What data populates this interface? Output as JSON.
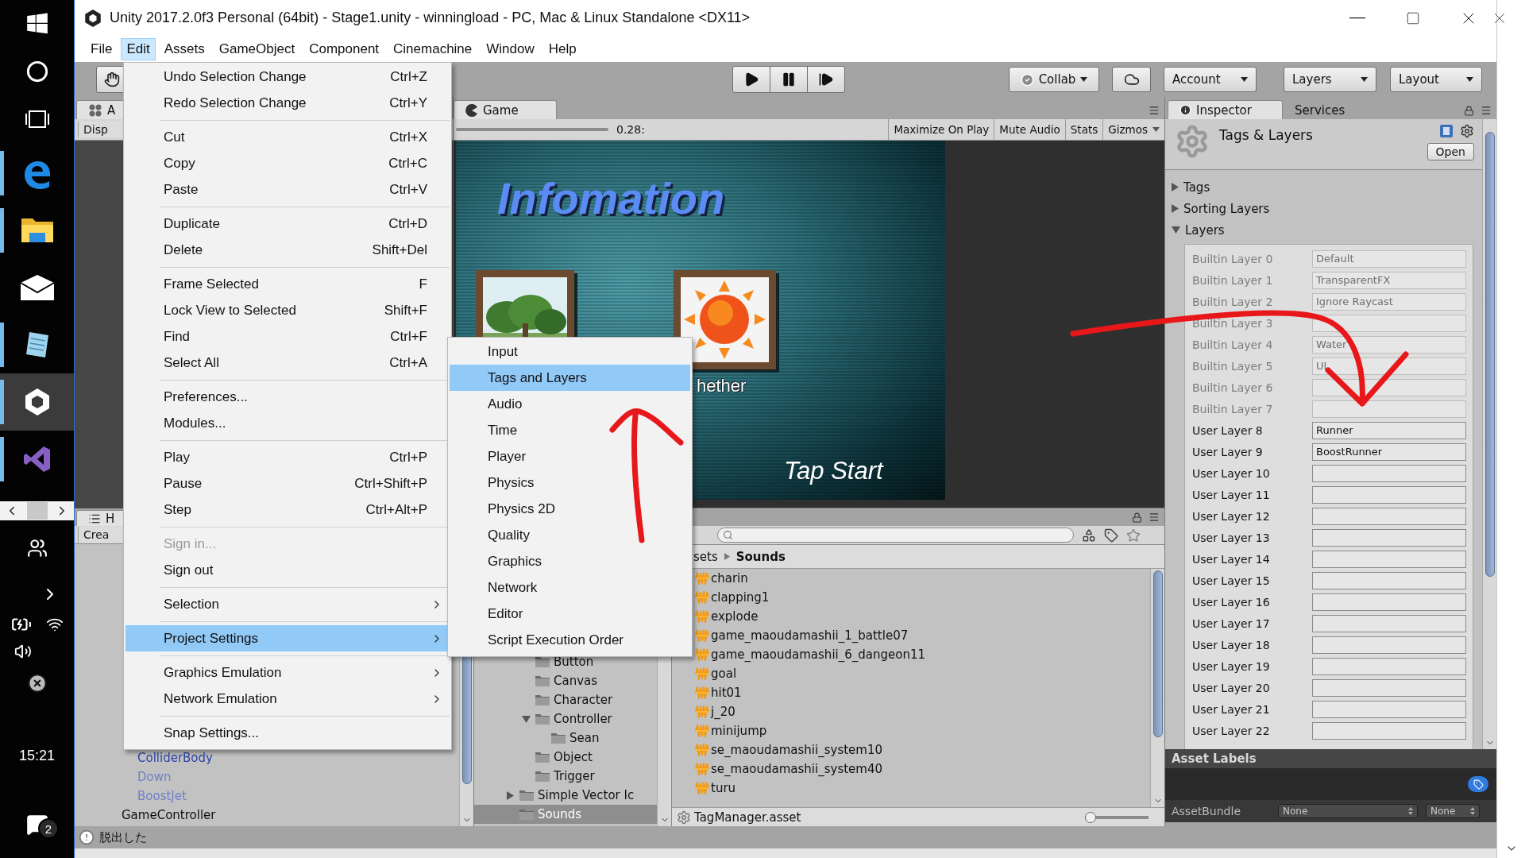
{
  "taskbar": {
    "apps": [
      {
        "kind": "edge",
        "running": true,
        "selected": false
      },
      {
        "kind": "explorer",
        "running": true,
        "selected": false
      },
      {
        "kind": "mail",
        "running": false,
        "selected": false
      },
      {
        "kind": "notepad",
        "running": true,
        "selected": false
      },
      {
        "kind": "unity",
        "running": true,
        "selected": true
      },
      {
        "kind": "studio",
        "running": true,
        "selected": false
      }
    ],
    "clock": "15:21",
    "notification_count": "2"
  },
  "window": {
    "title": "Unity 2017.2.0f3 Personal (64bit) - Stage1.unity - winningload - PC, Mac & Linux Standalone <DX11>"
  },
  "menubar": [
    {
      "label": "File",
      "selected": false
    },
    {
      "label": "Edit",
      "selected": true
    },
    {
      "label": "Assets",
      "selected": false
    },
    {
      "label": "GameObject",
      "selected": false
    },
    {
      "label": "Component",
      "selected": false
    },
    {
      "label": "Cinemachine",
      "selected": false
    },
    {
      "label": "Window",
      "selected": false
    },
    {
      "label": "Help",
      "selected": false
    }
  ],
  "toolbar": {
    "collab": "Collab",
    "account": "Account",
    "layers": "Layers",
    "layout": "Layout"
  },
  "scene_panel": {
    "tab": "A",
    "button": "Disp"
  },
  "game_panel": {
    "tab": "Game",
    "scale": "0.28:",
    "options": [
      "Maximize On Play",
      "Mute Audio",
      "Stats",
      "Gizmos"
    ],
    "title": "Infomation",
    "caption": "hether",
    "prompt": "Tap Start"
  },
  "hierarchy": {
    "tab": "H",
    "create": "Crea",
    "items": [
      {
        "children": [
          {
            "label": "ColliderBody",
            "kind": "prefab",
            "inactive": false
          },
          {
            "label": "Down",
            "kind": "prefab",
            "inactive": true
          },
          {
            "label": "BoostJet",
            "kind": "prefab",
            "inactive": true
          }
        ]
      },
      {
        "label": "GameController",
        "kind": "object",
        "inactive": false
      }
    ]
  },
  "project": {
    "folders": [
      {
        "children": [
          {
            "label": "Button",
            "selected": false
          },
          {
            "label": "Canvas",
            "selected": false
          },
          {
            "label": "Character",
            "selected": false
          },
          {
            "label": "Controller",
            "selected": false,
            "expanded": true,
            "children": [
              {
                "label": "Sean",
                "selected": false
              }
            ]
          },
          {
            "label": "Object",
            "selected": false
          },
          {
            "label": "Trigger",
            "selected": false
          }
        ]
      },
      {
        "label": "Simple Vector Ic",
        "selected": false,
        "expanded": false
      },
      {
        "label": "Sounds",
        "selected": true
      }
    ],
    "breadcrumb": [
      "sets",
      "Sounds"
    ],
    "files": [
      "charin",
      "clapping1",
      "explode",
      "game_maoudamashii_1_battle07",
      "game_maoudamashii_6_dangeon11",
      "goal",
      "hit01",
      "j_20",
      "minijump",
      "se_maoudamashii_system10",
      "se_maoudamashii_system40",
      "turu"
    ],
    "footer": "TagManager.asset",
    "icon_size_slider": {
      "level": 0
    }
  },
  "inspector": {
    "tabs": [
      {
        "label": "Inspector",
        "selected": true
      },
      {
        "label": "Services",
        "selected": false
      }
    ],
    "title": "Tags & Layers",
    "open": "Open",
    "sections": [
      {
        "label": "Tags",
        "expanded": false
      },
      {
        "label": "Sorting Layers",
        "expanded": false
      },
      {
        "label": "Layers",
        "expanded": true
      }
    ],
    "layers": [
      {
        "label": "Builtin Layer 0",
        "value": "Default",
        "disabled": true
      },
      {
        "label": "Builtin Layer 1",
        "value": "TransparentFX",
        "disabled": true
      },
      {
        "label": "Builtin Layer 2",
        "value": "Ignore Raycast",
        "disabled": true
      },
      {
        "label": "Builtin Layer 3",
        "disabled": true
      },
      {
        "label": "Builtin Layer 4",
        "value": "Water",
        "disabled": true
      },
      {
        "label": "Builtin Layer 5",
        "value": "UI",
        "disabled": true
      },
      {
        "label": "Builtin Layer 6",
        "disabled": true
      },
      {
        "label": "Builtin Layer 7",
        "disabled": true
      },
      {
        "label": "User Layer 8",
        "value": "Runner",
        "disabled": false
      },
      {
        "label": "User Layer 9",
        "value": "BoostRunner",
        "disabled": false
      },
      {
        "label": "User Layer 10",
        "disabled": false
      },
      {
        "label": "User Layer 11",
        "disabled": false
      },
      {
        "label": "User Layer 12",
        "disabled": false
      },
      {
        "label": "User Layer 13",
        "disabled": false
      },
      {
        "label": "User Layer 14",
        "disabled": false
      },
      {
        "label": "User Layer 15",
        "disabled": false
      },
      {
        "label": "User Layer 16",
        "disabled": false
      },
      {
        "label": "User Layer 17",
        "disabled": false
      },
      {
        "label": "User Layer 18",
        "disabled": false
      },
      {
        "label": "User Layer 19",
        "disabled": false
      },
      {
        "label": "User Layer 20",
        "disabled": false
      },
      {
        "label": "User Layer 21",
        "disabled": false
      },
      {
        "label": "User Layer 22",
        "disabled": false
      }
    ],
    "asset_labels": "Asset Labels",
    "bundle_label": "AssetBundle",
    "bundle_values": [
      "None",
      "None"
    ]
  },
  "edit_menu": {
    "groups": [
      [
        {
          "label": "Undo Selection Change",
          "shortcut": "Ctrl+Z",
          "disabled": false,
          "submenu": false,
          "selected": false
        },
        {
          "label": "Redo Selection Change",
          "shortcut": "Ctrl+Y",
          "disabled": false,
          "submenu": false,
          "selected": false
        }
      ],
      [
        {
          "label": "Cut",
          "shortcut": "Ctrl+X",
          "disabled": false,
          "submenu": false,
          "selected": false
        },
        {
          "label": "Copy",
          "shortcut": "Ctrl+C",
          "disabled": false,
          "submenu": false,
          "selected": false
        },
        {
          "label": "Paste",
          "shortcut": "Ctrl+V",
          "disabled": false,
          "submenu": false,
          "selected": false
        }
      ],
      [
        {
          "label": "Duplicate",
          "shortcut": "Ctrl+D",
          "disabled": false,
          "submenu": false,
          "selected": false
        },
        {
          "label": "Delete",
          "shortcut": "Shift+Del",
          "disabled": false,
          "submenu": false,
          "selected": false
        }
      ],
      [
        {
          "label": "Frame Selected",
          "shortcut": "F",
          "disabled": false,
          "submenu": false,
          "selected": false
        },
        {
          "label": "Lock View to Selected",
          "shortcut": "Shift+F",
          "disabled": false,
          "submenu": false,
          "selected": false
        },
        {
          "label": "Find",
          "shortcut": "Ctrl+F",
          "disabled": false,
          "submenu": false,
          "selected": false
        },
        {
          "label": "Select All",
          "shortcut": "Ctrl+A",
          "disabled": false,
          "submenu": false,
          "selected": false
        }
      ],
      [
        {
          "label": "Preferences...",
          "disabled": false,
          "submenu": false,
          "selected": false
        },
        {
          "label": "Modules...",
          "disabled": false,
          "submenu": false,
          "selected": false
        }
      ],
      [
        {
          "label": "Play",
          "shortcut": "Ctrl+P",
          "disabled": false,
          "submenu": false,
          "selected": false
        },
        {
          "label": "Pause",
          "shortcut": "Ctrl+Shift+P",
          "disabled": false,
          "submenu": false,
          "selected": false
        },
        {
          "label": "Step",
          "shortcut": "Ctrl+Alt+P",
          "disabled": false,
          "submenu": false,
          "selected": false
        }
      ],
      [
        {
          "label": "Sign in...",
          "disabled": true,
          "submenu": false,
          "selected": false
        },
        {
          "label": "Sign out",
          "disabled": false,
          "submenu": false,
          "selected": false
        }
      ],
      [
        {
          "label": "Selection",
          "disabled": false,
          "submenu": true,
          "selected": false
        }
      ],
      [
        {
          "label": "Project Settings",
          "disabled": false,
          "submenu": true,
          "selected": true
        }
      ],
      [
        {
          "label": "Graphics Emulation",
          "disabled": false,
          "submenu": true,
          "selected": false
        },
        {
          "label": "Network Emulation",
          "disabled": false,
          "submenu": true,
          "selected": false
        }
      ],
      [
        {
          "label": "Snap Settings...",
          "disabled": false,
          "submenu": false,
          "selected": false
        }
      ]
    ]
  },
  "project_settings_menu": [
    {
      "label": "Input",
      "selected": false
    },
    {
      "label": "Tags and Layers",
      "selected": true
    },
    {
      "label": "Audio",
      "selected": false
    },
    {
      "label": "Time",
      "selected": false
    },
    {
      "label": "Player",
      "selected": false
    },
    {
      "label": "Physics",
      "selected": false
    },
    {
      "label": "Physics 2D",
      "selected": false
    },
    {
      "label": "Quality",
      "selected": false
    },
    {
      "label": "Graphics",
      "selected": false
    },
    {
      "label": "Network",
      "selected": false
    },
    {
      "label": "Editor",
      "selected": false
    },
    {
      "label": "Script Execution Order",
      "selected": false
    }
  ],
  "status_bar": {
    "message": "脱出した"
  }
}
